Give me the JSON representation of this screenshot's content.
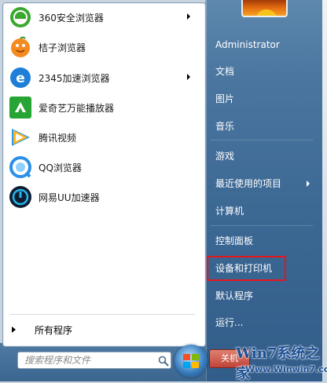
{
  "programs": [
    {
      "label": "360安全浏览器",
      "icon": "360-browser-icon",
      "has_arrow": true
    },
    {
      "label": "桔子浏览器",
      "icon": "orange-browser-icon",
      "has_arrow": false
    },
    {
      "label": "2345加速浏览器",
      "icon": "2345-browser-icon",
      "has_arrow": true
    },
    {
      "label": "爱奇艺万能播放器",
      "icon": "iqiyi-player-icon",
      "has_arrow": false
    },
    {
      "label": "腾讯视频",
      "icon": "tencent-video-icon",
      "has_arrow": false
    },
    {
      "label": "QQ浏览器",
      "icon": "qq-browser-icon",
      "has_arrow": false
    },
    {
      "label": "网易UU加速器",
      "icon": "netease-uu-icon",
      "has_arrow": false
    }
  ],
  "all_programs": "所有程序",
  "search": {
    "placeholder": "搜索程序和文件"
  },
  "right_items": [
    {
      "label": "Administrator",
      "has_arrow": false
    },
    {
      "label": "文档",
      "has_arrow": false
    },
    {
      "label": "图片",
      "has_arrow": false
    },
    {
      "label": "音乐",
      "has_arrow": false
    },
    {
      "label": "游戏",
      "has_arrow": false
    },
    {
      "label": "最近使用的项目",
      "has_arrow": true
    },
    {
      "label": "计算机",
      "has_arrow": false
    },
    {
      "label": "控制面板",
      "has_arrow": false
    },
    {
      "label": "设备和打印机",
      "has_arrow": false,
      "highlighted": true
    },
    {
      "label": "默认程序",
      "has_arrow": false
    },
    {
      "label": "运行...",
      "has_arrow": false
    }
  ],
  "shutdown": {
    "label": "关机"
  },
  "watermark": {
    "logo": "Win7系统之家",
    "url": "Www.Winwin7.com"
  },
  "colors": {
    "highlight_border": "#e8141c",
    "right_pane": "#3c6894"
  }
}
